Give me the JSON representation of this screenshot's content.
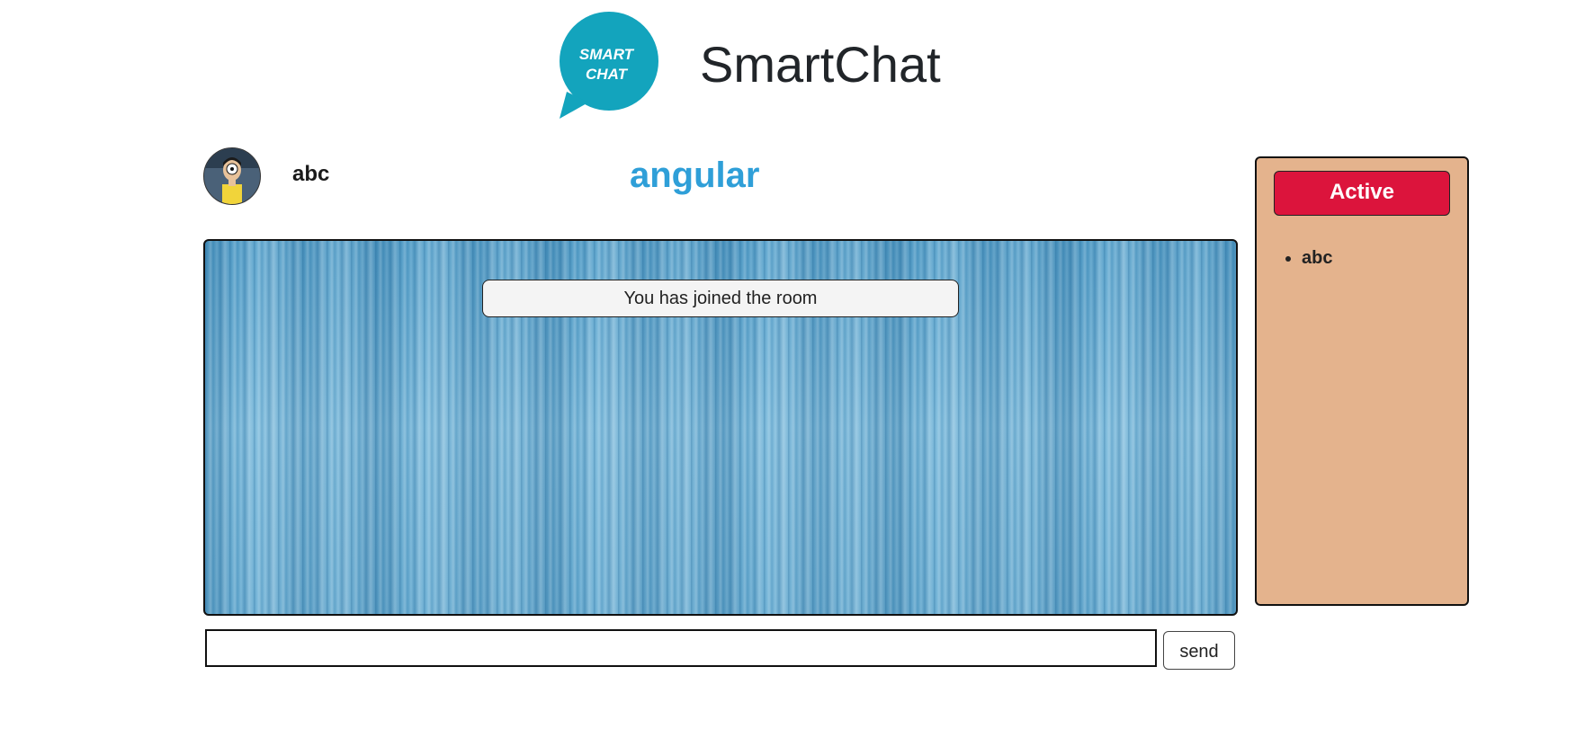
{
  "header": {
    "logo_text_line1": "SMART",
    "logo_text_line2": "CHAT",
    "app_title": "SmartChat",
    "logo_color": "#13a4bd"
  },
  "user": {
    "name": "abc",
    "avatar": "avatar-image"
  },
  "room": {
    "name": "angular",
    "name_color": "#2f9fd8"
  },
  "chat": {
    "messages": [
      {
        "type": "system",
        "text": "You has joined the room"
      }
    ]
  },
  "composer": {
    "input_value": "",
    "placeholder": "",
    "send_label": "send"
  },
  "active_panel": {
    "title": "Active",
    "title_color": "#dc143c",
    "panel_color": "#e4b38d",
    "users": [
      "abc"
    ]
  }
}
